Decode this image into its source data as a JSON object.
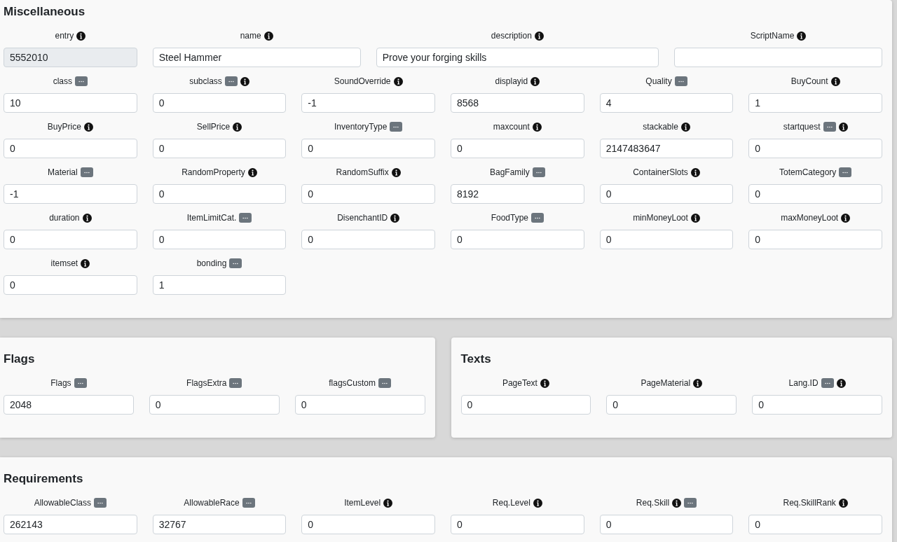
{
  "rows": [
    [
      {
        "title": "Miscellaneous",
        "fields": [
          {
            "label": "entry",
            "value": "5552010",
            "icons": [
              {
                "kind": "info"
              }
            ],
            "disabled": true
          },
          {
            "label": "name",
            "value": "Steel Hammer",
            "icons": [
              {
                "kind": "info"
              }
            ],
            "disabled": false
          },
          {
            "label": "description",
            "value": "Prove your forging skills",
            "icons": [
              {
                "kind": "info"
              }
            ],
            "disabled": false
          },
          {
            "label": "ScriptName",
            "icons": [
              {
                "kind": "info"
              }
            ],
            "disabled": false
          },
          {
            "label": "class",
            "value": "10",
            "icons": [
              {
                "kind": "picker"
              }
            ],
            "disabled": false
          },
          {
            "label": "subclass",
            "value": "0",
            "icons": [
              {
                "kind": "picker"
              },
              {
                "kind": "info"
              }
            ],
            "disabled": false
          },
          {
            "label": "SoundOverride",
            "value": "-1",
            "icons": [
              {
                "kind": "info"
              }
            ],
            "disabled": false
          },
          {
            "label": "displayid",
            "value": "8568",
            "icons": [
              {
                "kind": "info"
              }
            ],
            "disabled": false
          },
          {
            "label": "Quality",
            "value": "4",
            "icons": [
              {
                "kind": "picker"
              }
            ],
            "disabled": false
          },
          {
            "label": "BuyCount",
            "value": "1",
            "icons": [
              {
                "kind": "info"
              }
            ],
            "disabled": false
          },
          {
            "label": "BuyPrice",
            "value": "0",
            "icons": [
              {
                "kind": "info"
              }
            ],
            "disabled": false
          },
          {
            "label": "SellPrice",
            "value": "0",
            "icons": [
              {
                "kind": "info"
              }
            ],
            "disabled": false
          },
          {
            "label": "InventoryType",
            "value": "0",
            "icons": [
              {
                "kind": "picker"
              }
            ],
            "disabled": false
          },
          {
            "label": "maxcount",
            "value": "0",
            "icons": [
              {
                "kind": "info"
              }
            ],
            "disabled": false
          },
          {
            "label": "stackable",
            "value": "2147483647",
            "icons": [
              {
                "kind": "info"
              }
            ],
            "disabled": false
          },
          {
            "label": "startquest",
            "value": "0",
            "icons": [
              {
                "kind": "picker"
              },
              {
                "kind": "info"
              }
            ],
            "disabled": false
          },
          {
            "label": "Material",
            "value": "-1",
            "icons": [
              {
                "kind": "picker"
              }
            ],
            "disabled": false
          },
          {
            "label": "RandomProperty",
            "value": "0",
            "icons": [
              {
                "kind": "info"
              }
            ],
            "disabled": false
          },
          {
            "label": "RandomSuffix",
            "value": "0",
            "icons": [
              {
                "kind": "info"
              }
            ],
            "disabled": false
          },
          {
            "label": "BagFamily",
            "value": "8192",
            "icons": [
              {
                "kind": "picker"
              }
            ],
            "disabled": false
          },
          {
            "label": "ContainerSlots",
            "value": "0",
            "icons": [
              {
                "kind": "info"
              }
            ],
            "disabled": false
          },
          {
            "label": "TotemCategory",
            "value": "0",
            "icons": [
              {
                "kind": "picker"
              }
            ],
            "disabled": false
          },
          {
            "label": "duration",
            "value": "0",
            "icons": [
              {
                "kind": "info"
              }
            ],
            "disabled": false
          },
          {
            "label": "ItemLimitCat.",
            "value": "0",
            "icons": [
              {
                "kind": "picker"
              }
            ],
            "disabled": false
          },
          {
            "label": "DisenchantID",
            "value": "0",
            "icons": [
              {
                "kind": "info"
              }
            ],
            "disabled": false
          },
          {
            "label": "FoodType",
            "value": "0",
            "icons": [
              {
                "kind": "picker"
              }
            ],
            "disabled": false
          },
          {
            "label": "minMoneyLoot",
            "value": "0",
            "icons": [
              {
                "kind": "info"
              }
            ],
            "disabled": false
          },
          {
            "label": "maxMoneyLoot",
            "value": "0",
            "icons": [
              {
                "kind": "info"
              }
            ],
            "disabled": false
          },
          {
            "label": "itemset",
            "value": "0",
            "icons": [
              {
                "kind": "info"
              }
            ],
            "disabled": false
          },
          {
            "label": "bonding",
            "value": "1",
            "icons": [
              {
                "kind": "picker"
              }
            ],
            "disabled": false
          }
        ]
      }
    ],
    [
      {
        "title": "Flags",
        "fields": [
          {
            "label": "Flags",
            "value": "2048",
            "icons": [
              {
                "kind": "picker"
              }
            ],
            "disabled": false
          },
          {
            "label": "FlagsExtra",
            "value": "0",
            "icons": [
              {
                "kind": "picker"
              }
            ],
            "disabled": false
          },
          {
            "label": "flagsCustom",
            "value": "0",
            "icons": [
              {
                "kind": "picker"
              }
            ],
            "disabled": false
          }
        ]
      },
      {
        "title": "Texts",
        "fields": [
          {
            "label": "PageText",
            "value": "0",
            "icons": [
              {
                "kind": "info"
              }
            ],
            "disabled": false
          },
          {
            "label": "PageMaterial",
            "value": "0",
            "icons": [
              {
                "kind": "info"
              }
            ],
            "disabled": false
          },
          {
            "label": "Lang.ID",
            "value": "0",
            "icons": [
              {
                "kind": "picker"
              },
              {
                "kind": "info"
              }
            ],
            "disabled": false
          }
        ]
      }
    ],
    [
      {
        "title": "Requirements",
        "fields": [
          {
            "label": "AllowableClass",
            "value": "262143",
            "icons": [
              {
                "kind": "picker"
              }
            ],
            "disabled": false
          },
          {
            "label": "AllowableRace",
            "value": "32767",
            "icons": [
              {
                "kind": "picker"
              }
            ],
            "disabled": false
          },
          {
            "label": "ItemLevel",
            "value": "0",
            "icons": [
              {
                "kind": "info"
              }
            ],
            "disabled": false
          },
          {
            "label": "Req.Level",
            "value": "0",
            "icons": [
              {
                "kind": "info"
              }
            ],
            "disabled": false
          },
          {
            "label": "Req.Skill",
            "value": "0",
            "icons": [
              {
                "kind": "info"
              },
              {
                "kind": "picker"
              }
            ],
            "disabled": false
          },
          {
            "label": "Req.SkillRank",
            "value": "0",
            "icons": [
              {
                "kind": "info"
              }
            ],
            "disabled": false
          }
        ]
      }
    ]
  ]
}
